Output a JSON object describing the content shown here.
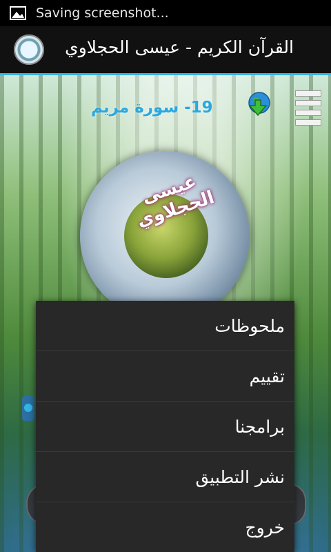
{
  "status_bar": {
    "notification_text": "Saving screenshot...",
    "icon": "image-icon"
  },
  "action_bar": {
    "title": "القرآن الكريم - عيسى الحجلاوي",
    "logo_icon": "app-logo-icon"
  },
  "main": {
    "surah_label": "19- سورة مريم",
    "reciter_name": "عيسى الحجلاوي",
    "download_icon": "download-globe-icon",
    "menu_icon": "hamburger-menu-icon"
  },
  "popup_menu": {
    "items": [
      {
        "label": "ملحوظات"
      },
      {
        "label": "تقييم"
      },
      {
        "label": "برامجنا"
      },
      {
        "label": "نشر التطبيق"
      },
      {
        "label": "خروج"
      }
    ]
  },
  "colors": {
    "accent": "#33b5e5",
    "menu_bg": "#282828",
    "surah_text": "#2aa8e0"
  }
}
